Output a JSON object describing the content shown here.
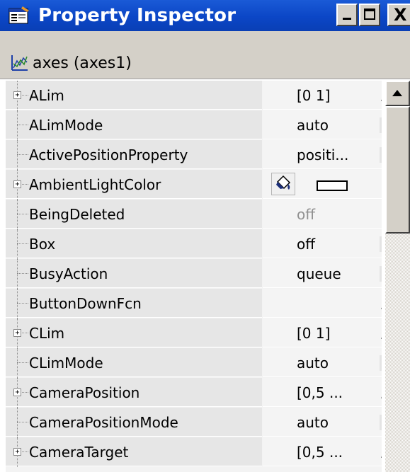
{
  "window": {
    "title": "Property Inspector",
    "minimize_icon": "minimize-icon",
    "maximize_icon": "maximize-icon",
    "close_label": "X"
  },
  "object": {
    "icon": "axes-icon",
    "label": "axes (axes1)"
  },
  "properties": [
    {
      "name": "ALim",
      "value": "[0 1]",
      "expandable": true,
      "control": "pencil"
    },
    {
      "name": "ALimMode",
      "value": "auto",
      "expandable": false,
      "control": "dropdown"
    },
    {
      "name": "ActivePositionProperty",
      "value": "positi...",
      "expandable": false,
      "control": "dropdown"
    },
    {
      "name": "AmbientLightColor",
      "value": "",
      "expandable": true,
      "control": "color"
    },
    {
      "name": "BeingDeleted",
      "value": "off",
      "expandable": false,
      "control": "none",
      "disabled": true
    },
    {
      "name": "Box",
      "value": "off",
      "expandable": false,
      "control": "dropdown"
    },
    {
      "name": "BusyAction",
      "value": "queue",
      "expandable": false,
      "control": "dropdown"
    },
    {
      "name": "ButtonDownFcn",
      "value": "",
      "expandable": false,
      "control": "pencil"
    },
    {
      "name": "CLim",
      "value": "[0 1]",
      "expandable": true,
      "control": "pencil"
    },
    {
      "name": "CLimMode",
      "value": "auto",
      "expandable": false,
      "control": "dropdown"
    },
    {
      "name": "CameraPosition",
      "value": "[0,5 ...",
      "expandable": true,
      "control": "pencil"
    },
    {
      "name": "CameraPositionMode",
      "value": "auto",
      "expandable": false,
      "control": "dropdown"
    },
    {
      "name": "CameraTarget",
      "value": "[0,5 ...",
      "expandable": true,
      "control": "pencil"
    }
  ],
  "colors": {
    "title_bar": "#0b46c6",
    "name_cell": "#e6e6e6",
    "value_cell": "#f4f4f4",
    "chrome": "#d4d0c8"
  }
}
